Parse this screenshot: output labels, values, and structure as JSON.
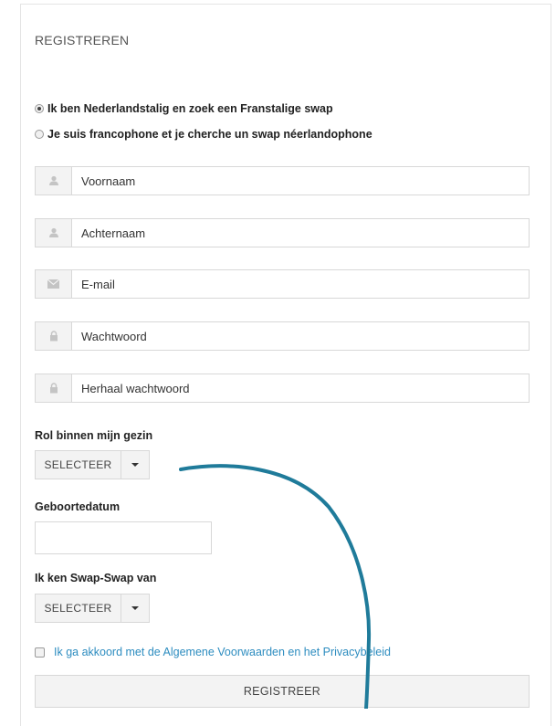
{
  "form": {
    "title": "REGISTREREN",
    "language_options": [
      {
        "label": "Ik ben Nederlandstalig en zoek een Franstalige swap",
        "selected": true
      },
      {
        "label": "Je suis francophone et je cherche un swap néerlandophone",
        "selected": false
      }
    ],
    "fields": {
      "first_name": {
        "placeholder": "Voornaam",
        "icon": "user-icon"
      },
      "last_name": {
        "placeholder": "Achternaam",
        "icon": "user-icon"
      },
      "email": {
        "placeholder": "E-mail",
        "icon": "envelope-icon"
      },
      "password": {
        "placeholder": "Wachtwoord",
        "icon": "lock-icon"
      },
      "password_repeat": {
        "placeholder": "Herhaal wachtwoord",
        "icon": "lock-icon"
      }
    },
    "role": {
      "label": "Rol binnen mijn gezin",
      "value": "SELECTEER"
    },
    "birthdate": {
      "label": "Geboortedatum",
      "value": ""
    },
    "referral": {
      "label": "Ik ken Swap-Swap van",
      "value": "SELECTEER"
    },
    "terms": {
      "label": "Ik ga akkoord met de Algemene Voorwaarden en het Privacybeleid",
      "checked": false
    },
    "submit_label": "REGISTREER"
  },
  "colors": {
    "link": "#2e8dc0",
    "annotation_stroke": "#1f7b9a"
  }
}
